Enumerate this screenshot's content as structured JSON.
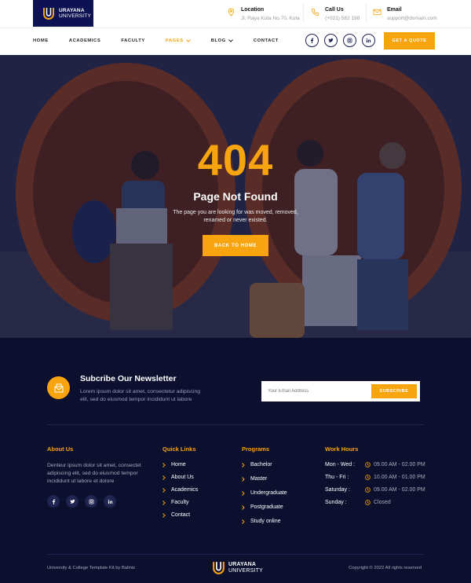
{
  "brand": {
    "name": "URAYANA",
    "sub": "UNIVERSITY",
    "color_primary": "#0d1252",
    "color_accent": "#f7a40e"
  },
  "topinfo": [
    {
      "icon": "location-pin-icon",
      "label": "Location",
      "value": "Jl. Raya Kuta No.70, Kuta"
    },
    {
      "icon": "phone-icon",
      "label": "Call Us",
      "value": "(+021) 582 198"
    },
    {
      "icon": "email-icon",
      "label": "Email",
      "value": "support@domain.com"
    }
  ],
  "nav": [
    {
      "label": "HOME"
    },
    {
      "label": "ACADEMICS"
    },
    {
      "label": "FACULTY"
    },
    {
      "label": "PAGES",
      "active": true
    },
    {
      "label": "BLOG"
    },
    {
      "label": "CONTACT"
    }
  ],
  "quote_button": "GET A QUOTE",
  "hero": {
    "code": "404",
    "title": "Page Not Found",
    "description": "The page you are looking for was moved, removed, renamed or never existed.",
    "button": "BACK TO HOME"
  },
  "newsletter": {
    "title": "Subcribe Our Newsletter",
    "description": "Lorem ipsum dolor sit amet, consectetur adipiscing elit, sed do eiusmod tempor incididunt ut labore",
    "placeholder": "Your Email Address",
    "button": "SUBSCRIBE"
  },
  "about": {
    "title": "About Us",
    "text": "Denteur ipsum dolor sit amet, consectet adipiscing elit, sed do eiusmod tempor incididunt ut labore et dolore"
  },
  "quick_links": {
    "title": "Quick Links",
    "items": [
      "Home",
      "About Us",
      "Academics",
      "Faculty",
      "Contact"
    ]
  },
  "programs": {
    "title": "Programs",
    "items": [
      "Bachelor",
      "Master",
      "Undergraduate",
      "Postgraduate",
      "Study online"
    ]
  },
  "work_hours": {
    "title": "Work Hours",
    "rows": [
      {
        "day": "Mon - Wed :",
        "time": "09.00 AM - 02.00 PM"
      },
      {
        "day": "Thu - Fri :",
        "time": "10.00 AM - 01.00 PM"
      },
      {
        "day": "Saturday :",
        "time": "09.00 AM - 02.00 PM"
      },
      {
        "day": "Sunday :",
        "time": "Closed"
      }
    ]
  },
  "footer_bottom": {
    "left": "University & College Template Kit by Baliniz",
    "right": "Copyright © 2022 All rights reserved"
  }
}
